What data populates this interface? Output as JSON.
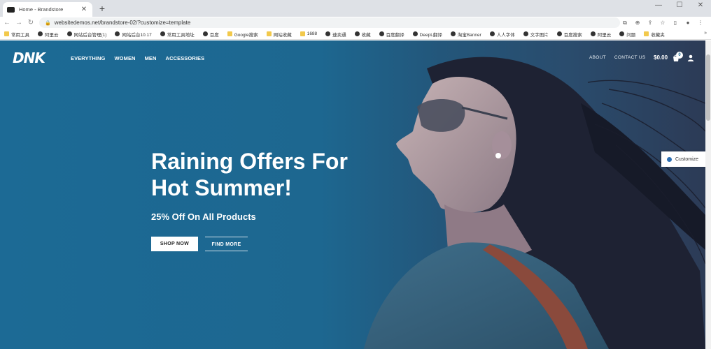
{
  "browser": {
    "tab_title": "Home - Brandstore",
    "url": "websitedemos.net/brandstore-02/?customize=template",
    "bookmarks": [
      {
        "label": "常用工具",
        "icon": "folder"
      },
      {
        "label": "阿里云",
        "icon": "globe"
      },
      {
        "label": "网站后台管理(1)",
        "icon": "globe"
      },
      {
        "label": "网站后台10.17",
        "icon": "globe"
      },
      {
        "label": "常用工具地址",
        "icon": "globe"
      },
      {
        "label": "百度",
        "icon": "globe"
      },
      {
        "label": "Google搜索",
        "icon": "folder"
      },
      {
        "label": "网站收藏",
        "icon": "folder"
      },
      {
        "label": "1688",
        "icon": "folder"
      },
      {
        "label": "速卖通",
        "icon": "globe"
      },
      {
        "label": "收藏",
        "icon": "globe"
      },
      {
        "label": "百度翻译",
        "icon": "globe"
      },
      {
        "label": "DeepL翻译",
        "icon": "globe"
      },
      {
        "label": "淘宝Banner",
        "icon": "globe"
      },
      {
        "label": "人人字体",
        "icon": "globe"
      },
      {
        "label": "文字图片",
        "icon": "globe"
      },
      {
        "label": "百度搜索",
        "icon": "globe"
      },
      {
        "label": "阿里云",
        "icon": "globe"
      },
      {
        "label": "问题",
        "icon": "globe"
      },
      {
        "label": "收藏夹",
        "icon": "folder"
      }
    ]
  },
  "header": {
    "logo": "DNK",
    "nav": [
      "EVERYTHING",
      "WOMEN",
      "MEN",
      "ACCESSORIES"
    ],
    "util_nav": [
      "ABOUT",
      "CONTACT US"
    ],
    "cart_total": "$0.00",
    "cart_count": "0"
  },
  "hero": {
    "title_line1": "Raining Offers For",
    "title_line2": "Hot Summer!",
    "subtitle": "25% Off On All Products",
    "primary_button": "SHOP NOW",
    "secondary_button": "FIND MORE"
  },
  "customize": {
    "label": "Customize"
  },
  "colors": {
    "hero_blue": "#1d6790",
    "hero_dark": "#2c3a55",
    "white": "#ffffff"
  }
}
